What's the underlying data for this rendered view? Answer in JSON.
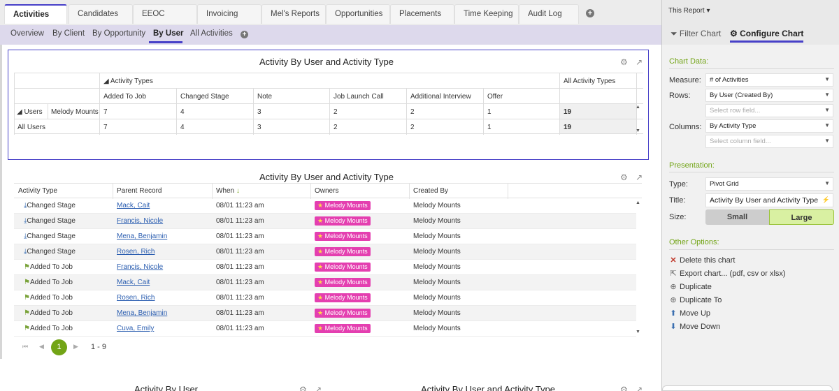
{
  "top_tabs": [
    "Activities",
    "Candidates",
    "EEOC",
    "Invoicing",
    "Mel's Reports",
    "Opportunities",
    "Placements",
    "Time Keeping",
    "Audit Log"
  ],
  "sub_tabs": [
    "Overview",
    "By Client",
    "By Opportunity",
    "By User",
    "All Activities"
  ],
  "add_glyph": "+",
  "panel1": {
    "title": "Activity By User and Activity Type",
    "icons": "⚙ ↗",
    "col_group_label": "◢ Activity Types",
    "total_header": "All Activity Types",
    "columns": [
      "Added To Job",
      "Changed Stage",
      "Note",
      "Job Launch Call",
      "Additional Interview",
      "Offer"
    ],
    "row_group_label": "◢ Users",
    "user_name": "Melody Mounts",
    "user_values": [
      "7",
      "4",
      "3",
      "2",
      "2",
      "1"
    ],
    "user_total": "19",
    "all_label": "All Users",
    "all_values": [
      "7",
      "4",
      "3",
      "2",
      "2",
      "1"
    ],
    "all_total": "19"
  },
  "panel2": {
    "title": "Activity By User and Activity Type",
    "icons": "⚙ ↗",
    "headers": {
      "type": "Activity Type",
      "parent": "Parent Record",
      "when": "When",
      "sort_arrow": "↓",
      "owners": "Owners",
      "created": "Created By"
    },
    "rows": [
      {
        "type": "Changed Stage",
        "kind": "changed",
        "parent": "Mack, Cait",
        "when": "08/01 11:23 am",
        "owner": "Melody Mounts",
        "created": "Melody Mounts"
      },
      {
        "type": "Changed Stage",
        "kind": "changed",
        "parent": "Francis, Nicole",
        "when": "08/01 11:23 am",
        "owner": "Melody Mounts",
        "created": "Melody Mounts"
      },
      {
        "type": "Changed Stage",
        "kind": "changed",
        "parent": "Mena, Benjamin",
        "when": "08/01 11:23 am",
        "owner": "Melody Mounts",
        "created": "Melody Mounts"
      },
      {
        "type": "Changed Stage",
        "kind": "changed",
        "parent": "Rosen, Rich",
        "when": "08/01 11:23 am",
        "owner": "Melody Mounts",
        "created": "Melody Mounts"
      },
      {
        "type": "Added To Job",
        "kind": "added",
        "parent": "Francis, Nicole",
        "when": "08/01 11:23 am",
        "owner": "Melody Mounts",
        "created": "Melody Mounts"
      },
      {
        "type": "Added To Job",
        "kind": "added",
        "parent": "Mack, Cait",
        "when": "08/01 11:23 am",
        "owner": "Melody Mounts",
        "created": "Melody Mounts"
      },
      {
        "type": "Added To Job",
        "kind": "added",
        "parent": "Rosen, Rich",
        "when": "08/01 11:23 am",
        "owner": "Melody Mounts",
        "created": "Melody Mounts"
      },
      {
        "type": "Added To Job",
        "kind": "added",
        "parent": "Mena, Benjamin",
        "when": "08/01 11:23 am",
        "owner": "Melody Mounts",
        "created": "Melody Mounts"
      },
      {
        "type": "Added To Job",
        "kind": "added",
        "parent": "Cuva, Emily",
        "when": "08/01 11:23 am",
        "owner": "Melody Mounts",
        "created": "Melody Mounts"
      }
    ],
    "pager": {
      "first": "⏮",
      "prev": "◀",
      "current": "1",
      "next": "▶",
      "range": "1 - 9"
    }
  },
  "bottom_titles": [
    "Activity By User",
    "Activity By User and Activity Type"
  ],
  "sidebar": {
    "report_selector": "This Report ▾",
    "tab_filter": "⏷ Filter Chart",
    "tab_configure": "⚙ Configure Chart",
    "chart_data_heading": "Chart Data:",
    "measure_label": "Measure:",
    "measure_value": "# of Activities",
    "rows_label": "Rows:",
    "rows_value": "By User (Created By)",
    "rows_placeholder": "Select row field...",
    "columns_label": "Columns:",
    "columns_value": "By Activity Type",
    "columns_placeholder": "Select column field...",
    "presentation_heading": "Presentation:",
    "type_label": "Type:",
    "type_value": "Pivot Grid",
    "title_label": "Title:",
    "title_value": "Activity By User and Activity Type",
    "size_label": "Size:",
    "size_small": "Small",
    "size_large": "Large",
    "other_heading": "Other Options:",
    "options": [
      {
        "icon": "✕",
        "label": "Delete this chart"
      },
      {
        "icon": "⇱",
        "label": "Export chart... (pdf, csv or xlsx)"
      },
      {
        "icon": "⊕",
        "label": "Duplicate"
      },
      {
        "icon": "⊕",
        "label": "Duplicate To"
      },
      {
        "icon": "⬆",
        "label": "Move Up"
      },
      {
        "icon": "⬇",
        "label": "Move Down"
      }
    ]
  },
  "colors": {
    "accent": "#4740c8",
    "green": "#72a416",
    "owner_badge": "#e43fb0",
    "link": "#2a5db0"
  }
}
